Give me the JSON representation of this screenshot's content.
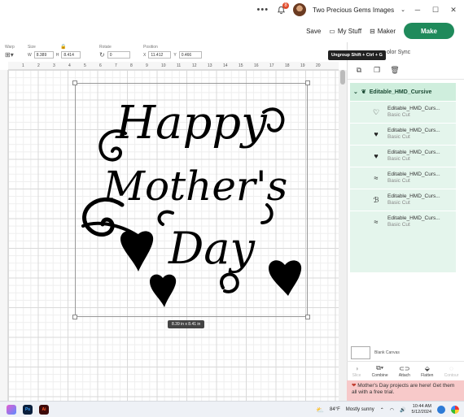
{
  "topbar": {
    "menu_dots": "•••",
    "notification_count": "8",
    "account_name": "Two Precious Gems Images",
    "minimize": "─",
    "maximize": "☐",
    "close": "✕"
  },
  "header": {
    "save_label": "Save",
    "mystuff_label": "My Stuff",
    "maker_label": "Maker",
    "make_label": "Make"
  },
  "properties": {
    "warp_label": "Warp",
    "size_label": "Size",
    "size_w_label": "W",
    "size_w": "8.389",
    "size_h_label": "H",
    "size_h": "8.414",
    "rotate_label": "Rotate",
    "rotate_value": "0",
    "position_label": "Position",
    "pos_x_label": "X",
    "pos_x": "11.412",
    "pos_y_label": "Y",
    "pos_y": "0.466"
  },
  "ruler": {
    "ticks": [
      "1",
      "2",
      "3",
      "4",
      "5",
      "6",
      "7",
      "8",
      "9",
      "10",
      "11",
      "12",
      "13",
      "14",
      "15",
      "16",
      "17",
      "18",
      "19",
      "20"
    ]
  },
  "canvas": {
    "artwork_line1": "Happy",
    "artwork_line2": "Mother's",
    "artwork_line3": "Day",
    "dimensions": "8.39  in x 8.41  in"
  },
  "tooltip": {
    "text": "Ungroup Shift + Ctrl + G"
  },
  "panel": {
    "color_sync": "olor Sync",
    "group_name": "Editable_HMD_Cursive",
    "layers": [
      {
        "name": "Editable_HMD_Curs...",
        "type": "Basic Cut",
        "icon": "heart-outline-icon"
      },
      {
        "name": "Editable_HMD_Curs...",
        "type": "Basic Cut",
        "icon": "heart-icon"
      },
      {
        "name": "Editable_HMD_Curs...",
        "type": "Basic Cut",
        "icon": "heart-icon"
      },
      {
        "name": "Editable_HMD_Curs...",
        "type": "Basic Cut",
        "icon": "swirl-icon"
      },
      {
        "name": "Editable_HMD_Curs...",
        "type": "Basic Cut",
        "icon": "script-icon"
      },
      {
        "name": "Editable_HMD_Curs...",
        "type": "Basic Cut",
        "icon": "swirl-icon"
      }
    ],
    "blank_canvas": "Blank Canvas"
  },
  "actions": {
    "slice": "Slice",
    "combine": "Combine",
    "attach": "Attach",
    "flatten": "Flatten",
    "contour": "Contour"
  },
  "promo": {
    "text": "Mother's Day projects are here! Get them all with a free trial."
  },
  "taskbar": {
    "temperature": "84°F",
    "weather": "Mostly sunny",
    "time": "10:44 AM",
    "date": "5/12/2024"
  },
  "colors": {
    "make_button": "#1f8a5b",
    "layer_group_bg": "#e4f5ec",
    "promo_bg": "#f7c9c9"
  }
}
